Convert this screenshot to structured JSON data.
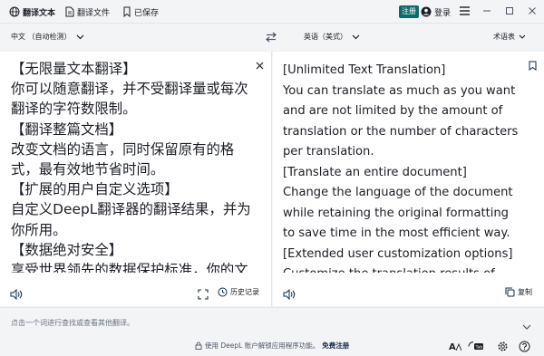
{
  "titlebar": {
    "tabs": [
      {
        "label": "翻译文本",
        "icon": "globe-icon",
        "active": true
      },
      {
        "label": "翻译文件",
        "icon": "document-icon",
        "active": false
      },
      {
        "label": "已保存",
        "icon": "bookmark-icon",
        "active": false
      }
    ],
    "register_label": "注册",
    "login_label": "登录"
  },
  "langbar": {
    "source_lang": "中文 （自动检测）",
    "target_lang": "英语（美式）",
    "glossary_label": "术语表"
  },
  "source": {
    "lines": [
      "【无限量文本翻译】",
      "你可以随意翻译，并不受翻译量或每次",
      "翻译的字符数限制。",
      "【翻译整篇文档】",
      "改变文档的语言，同时保留原有的格",
      "式，最有效地节省时间。",
      "【扩展的用户自定义选项】",
      "自定义DeepL翻译器的翻译结果，并为",
      "你所用。",
      "【数据绝对安全】",
      "享受世界领先的数据保护标准，你的文"
    ],
    "history_label": "历史记录"
  },
  "target": {
    "lines": [
      "[Unlimited Text Translation]",
      "You can translate as much as you want",
      "and are not limited by the amount of",
      "translation or the number of characters",
      "per translation.",
      "[Translate an entire document]",
      "Change the language of the document",
      "while retaining the original formatting",
      "to save time in the most efficient way.",
      "[Extended user customization options]",
      "Customize the translation results of"
    ],
    "copy_label": "复制"
  },
  "suggest": {
    "text": "点击一个词进行查找或查看其他翻译。"
  },
  "bottombar": {
    "promo_text": "使用 DeepL 账户解锁应用程序功能。",
    "promo_link": "免费注册"
  },
  "colors": {
    "accent": "#0f6b6b",
    "link": "#0f2b46",
    "background": "#f3f4f6",
    "panel": "#ffffff"
  }
}
